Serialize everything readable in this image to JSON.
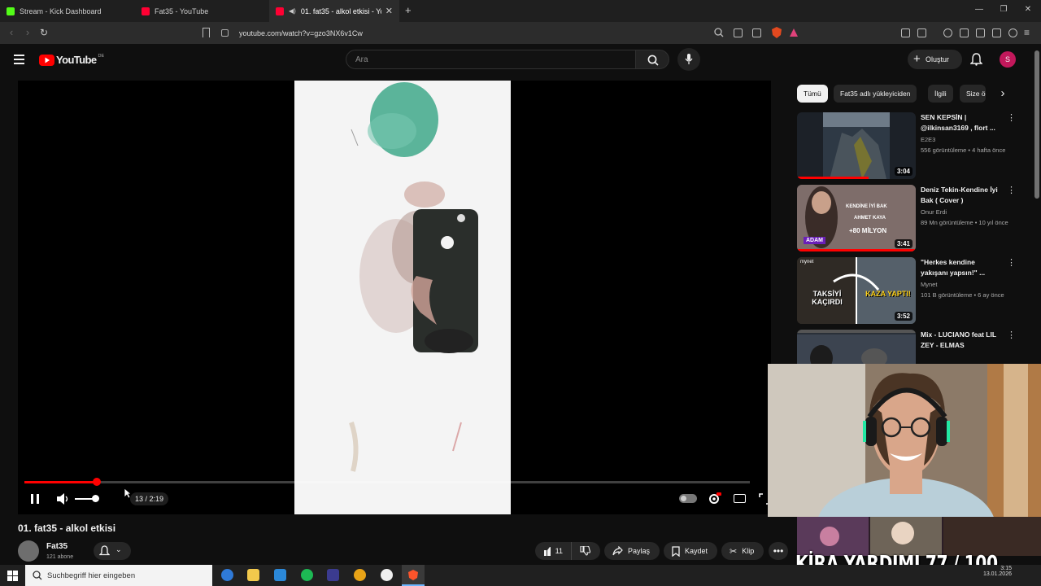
{
  "browser": {
    "tabs": [
      {
        "title": "Stream - Kick Dashboard",
        "favicon_color": "#53fc18"
      },
      {
        "title": "Fat35 - YouTube",
        "favicon_color": "#ff0033"
      },
      {
        "title": "01. fat35 - alkol etkisi - YouTube",
        "favicon_color": "#ff0033",
        "active": true
      }
    ],
    "new_tab_label": "+",
    "url": "youtube.com/watch?v=gzo3NX6v1Cw"
  },
  "youtube": {
    "logo_text": "YouTube",
    "region": "DE",
    "search_placeholder": "Ara",
    "create_label": "Oluştur",
    "avatar_letter": "S"
  },
  "player": {
    "progress_fraction": 0.1,
    "time_text": "0:13 / 2:19",
    "time_visible": "13 / 2:19"
  },
  "video": {
    "title": "01. fat35 - alkol etkisi",
    "channel": "Fat35",
    "subscribers": "121 abone",
    "likes": "11",
    "share_label": "Paylaş",
    "save_label": "Kaydet",
    "clip_label": "Klip"
  },
  "chips": [
    "Tümü",
    "Fat35 adlı yükleyiciden",
    "İlgili",
    "Size ö"
  ],
  "recommendations": [
    {
      "title": "SEN KEPSİN | @ilkinsan3169 , flort ...",
      "channel": "E2E3",
      "meta": "556 görüntüleme • 4 hafta önce",
      "duration": "3:04",
      "watched": 0.6
    },
    {
      "title": "Deniz Tekin-Kendine İyi Bak ( Cover )",
      "channel": "Onur Erdi",
      "meta": "89 Mn görüntüleme • 10 yıl önce",
      "duration": "3:41",
      "watched": 1.0,
      "thumb_text_1": "KENDİNE İYİ BAK",
      "thumb_text_2": "AHMET KAYA",
      "thumb_text_3": "+80 MİLYON",
      "thumb_text_4": "ADAM"
    },
    {
      "title": "\"Herkes kendine yakışanı yapsın!\" ...",
      "channel": "Mynet",
      "meta": "101 B görüntüleme • 6 ay önce",
      "duration": "3:52",
      "watched": 0,
      "thumb_text_1": "TAKSİYİ KAÇIRDI",
      "thumb_text_2": "KAZA YAPTI!",
      "thumb_text_3": "mynet"
    },
    {
      "title": "Mix - LUCIANO feat LIL ZEY - ELMAS",
      "channel": "",
      "meta": "",
      "duration": "",
      "watched": 0
    }
  ],
  "overlay": {
    "kira_text": "KİRA YARDIMI  77 / 100"
  },
  "taskbar": {
    "search_placeholder": "Suchbegriff hier eingeben",
    "time": "3:15",
    "date": "13.01.2026"
  }
}
